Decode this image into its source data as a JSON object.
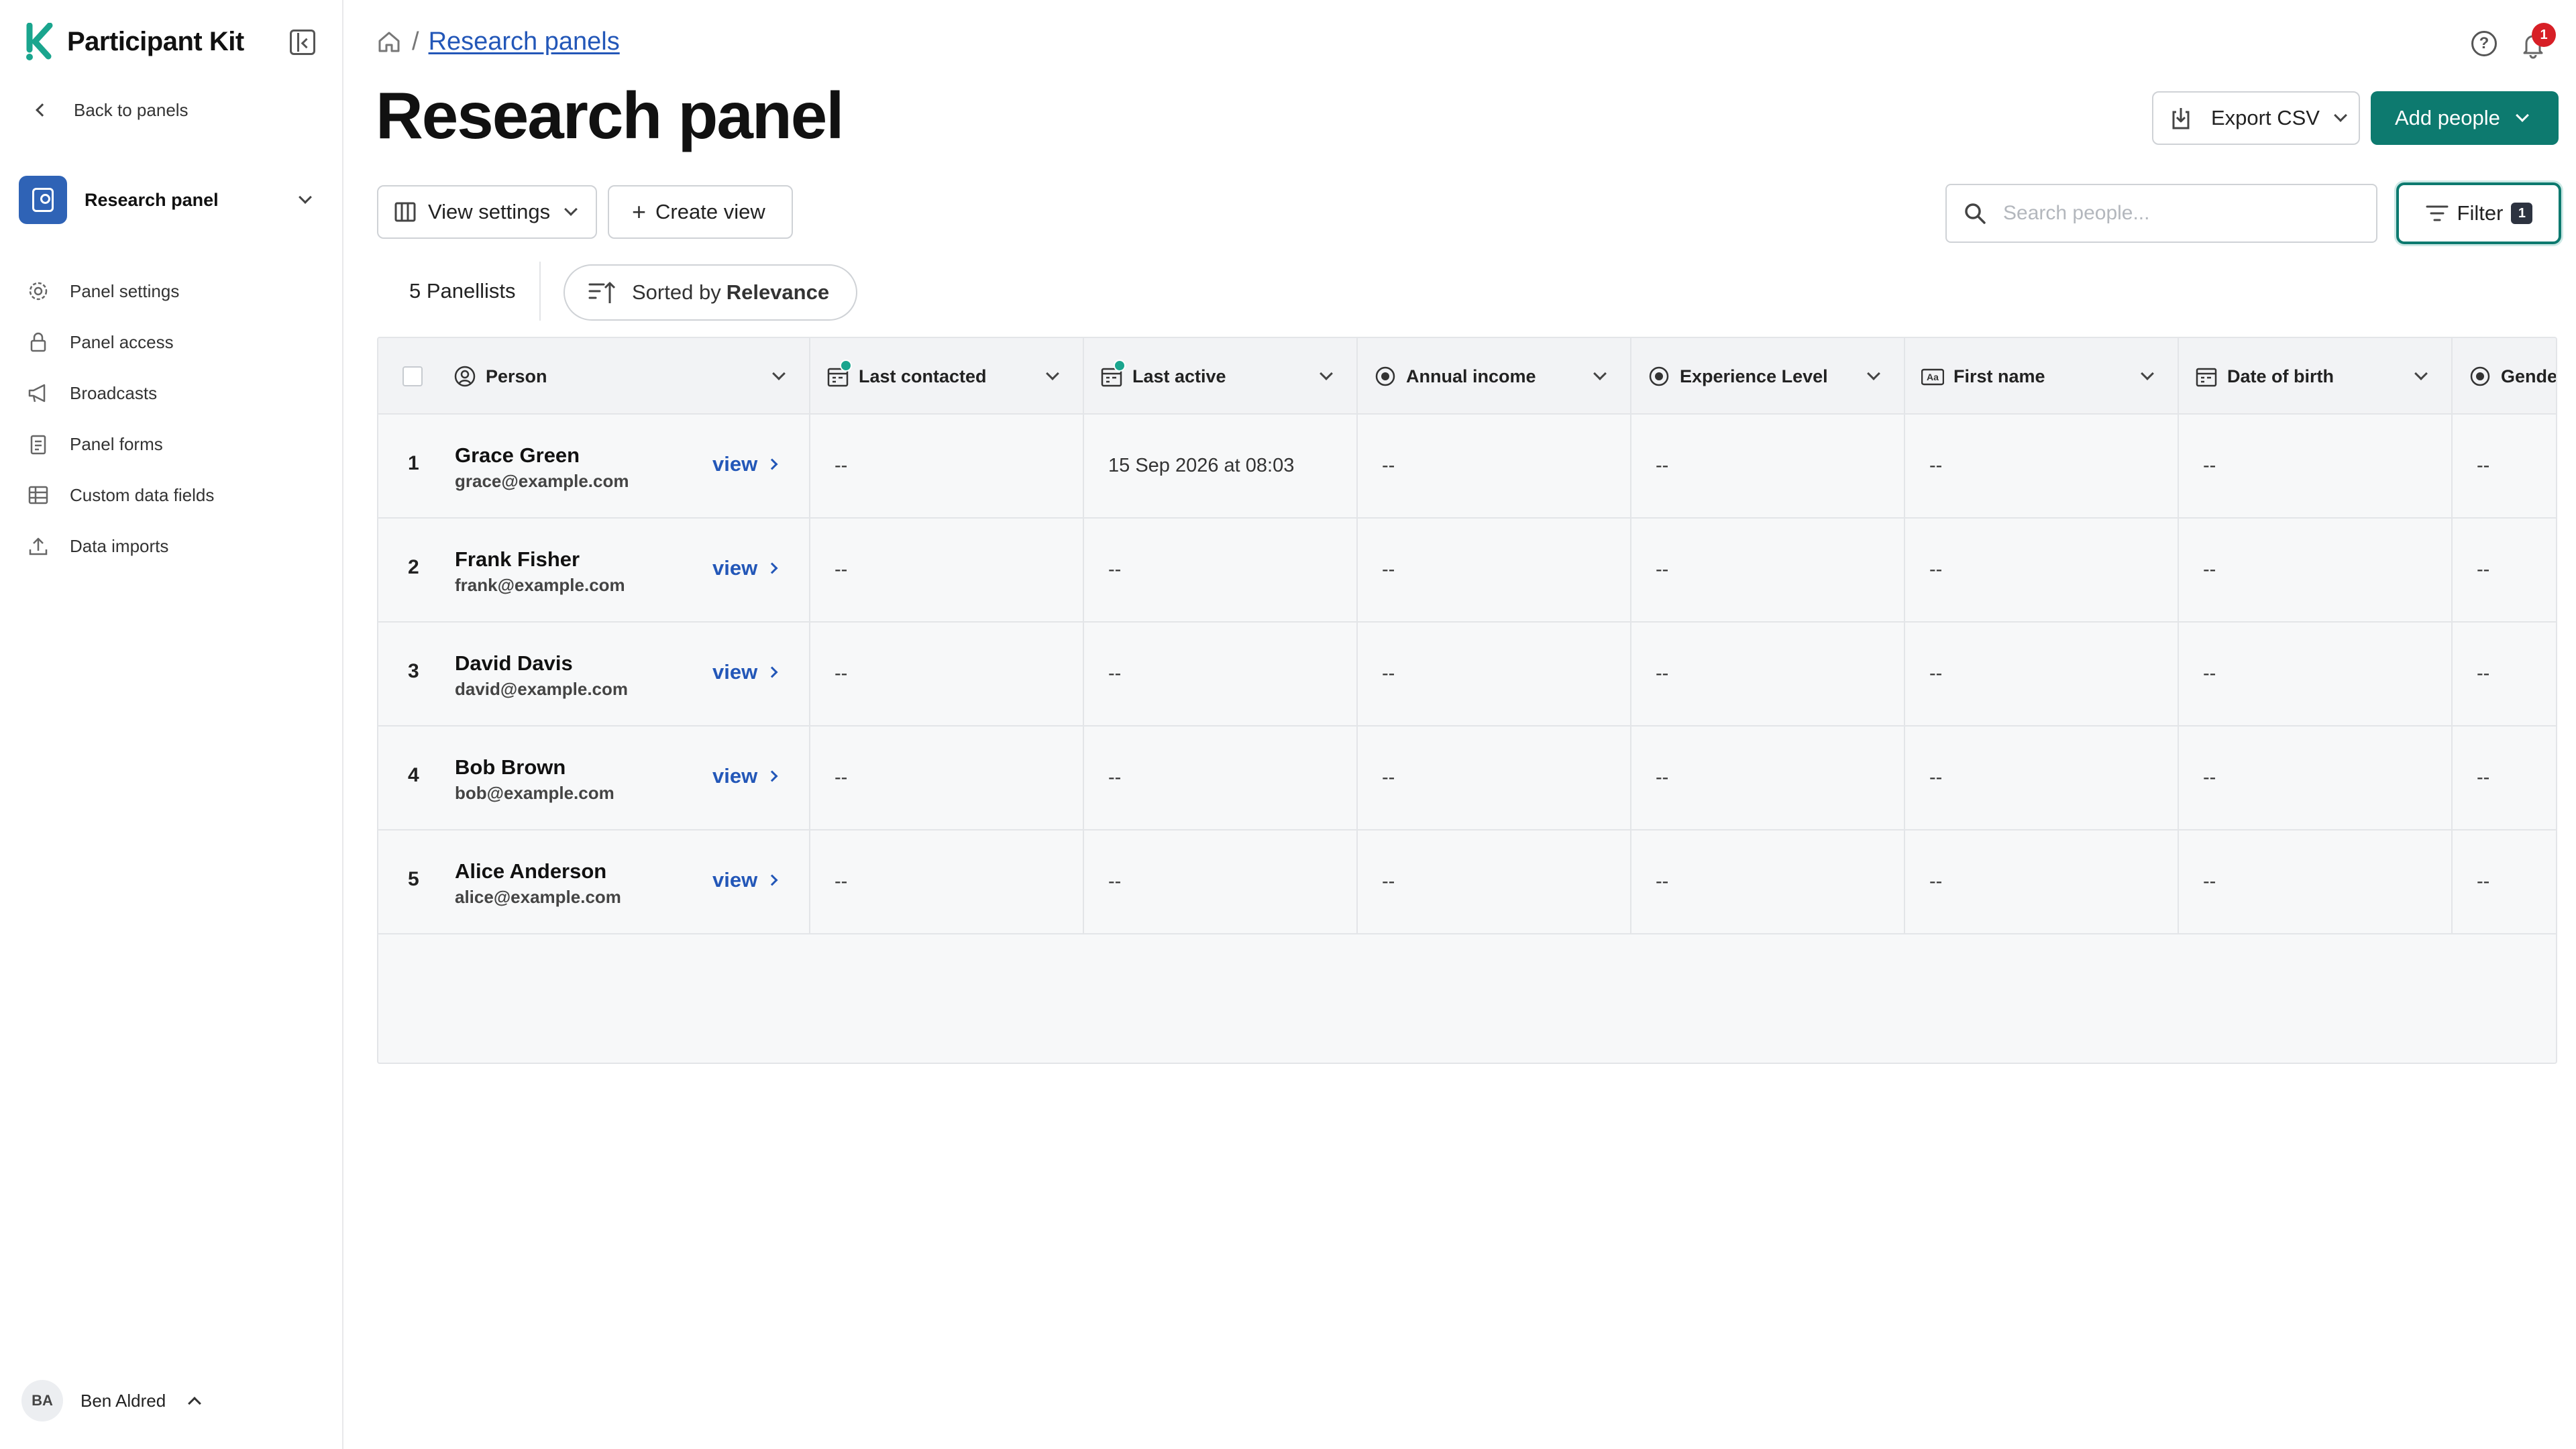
{
  "app": {
    "brand_name": "Participant Kit",
    "accent_color": "#0d7a6f",
    "link_color": "#2357b8"
  },
  "sidebar": {
    "back_label": "Back to panels",
    "panel_name": "Research panel",
    "items": [
      {
        "label": "Panel settings",
        "icon": "gear-icon"
      },
      {
        "label": "Panel access",
        "icon": "lock-icon"
      },
      {
        "label": "Broadcasts",
        "icon": "megaphone-icon"
      },
      {
        "label": "Panel forms",
        "icon": "clipboard-icon"
      },
      {
        "label": "Custom data fields",
        "icon": "table-icon"
      },
      {
        "label": "Data imports",
        "icon": "upload-icon"
      }
    ],
    "user": {
      "initials": "BA",
      "name": "Ben Aldred"
    }
  },
  "header": {
    "breadcrumb_link": "Research panels",
    "breadcrumb_sep": "/",
    "notification_count": "1",
    "help_glyph": "?"
  },
  "main": {
    "title": "Research panel",
    "export_label": "Export CSV",
    "add_label": "Add people",
    "view_settings_label": "View settings",
    "create_view_label": "Create view",
    "search_placeholder": "Search people...",
    "filter_label": "Filter",
    "filter_count": "1",
    "panellist_count": "5 Panellists",
    "sorted_prefix": "Sorted by",
    "sorted_value": "Relevance"
  },
  "table": {
    "columns": [
      {
        "label": "Person",
        "icon": "person-circle-icon"
      },
      {
        "label": "Last contacted",
        "icon": "calendar-icon"
      },
      {
        "label": "Last active",
        "icon": "calendar-icon"
      },
      {
        "label": "Annual income",
        "icon": "radio-icon"
      },
      {
        "label": "Experience Level",
        "icon": "radio-icon"
      },
      {
        "label": "First name",
        "icon": "text-icon"
      },
      {
        "label": "Date of birth",
        "icon": "calendar-icon"
      },
      {
        "label": "Gende",
        "icon": "radio-icon"
      }
    ],
    "text_icon_glyph": "Aa",
    "view_label": "view",
    "rows": [
      {
        "num": "1",
        "name": "Grace Green",
        "email": "grace@example.com",
        "cells": [
          "--",
          "15 Sep 2026 at 08:03",
          "--",
          "--",
          "--",
          "--",
          "--"
        ]
      },
      {
        "num": "2",
        "name": "Frank Fisher",
        "email": "frank@example.com",
        "cells": [
          "--",
          "--",
          "--",
          "--",
          "--",
          "--",
          "--"
        ]
      },
      {
        "num": "3",
        "name": "David Davis",
        "email": "david@example.com",
        "cells": [
          "--",
          "--",
          "--",
          "--",
          "--",
          "--",
          "--"
        ]
      },
      {
        "num": "4",
        "name": "Bob Brown",
        "email": "bob@example.com",
        "cells": [
          "--",
          "--",
          "--",
          "--",
          "--",
          "--",
          "--"
        ]
      },
      {
        "num": "5",
        "name": "Alice Anderson",
        "email": "alice@example.com",
        "cells": [
          "--",
          "--",
          "--",
          "--",
          "--",
          "--",
          "--"
        ]
      }
    ]
  }
}
